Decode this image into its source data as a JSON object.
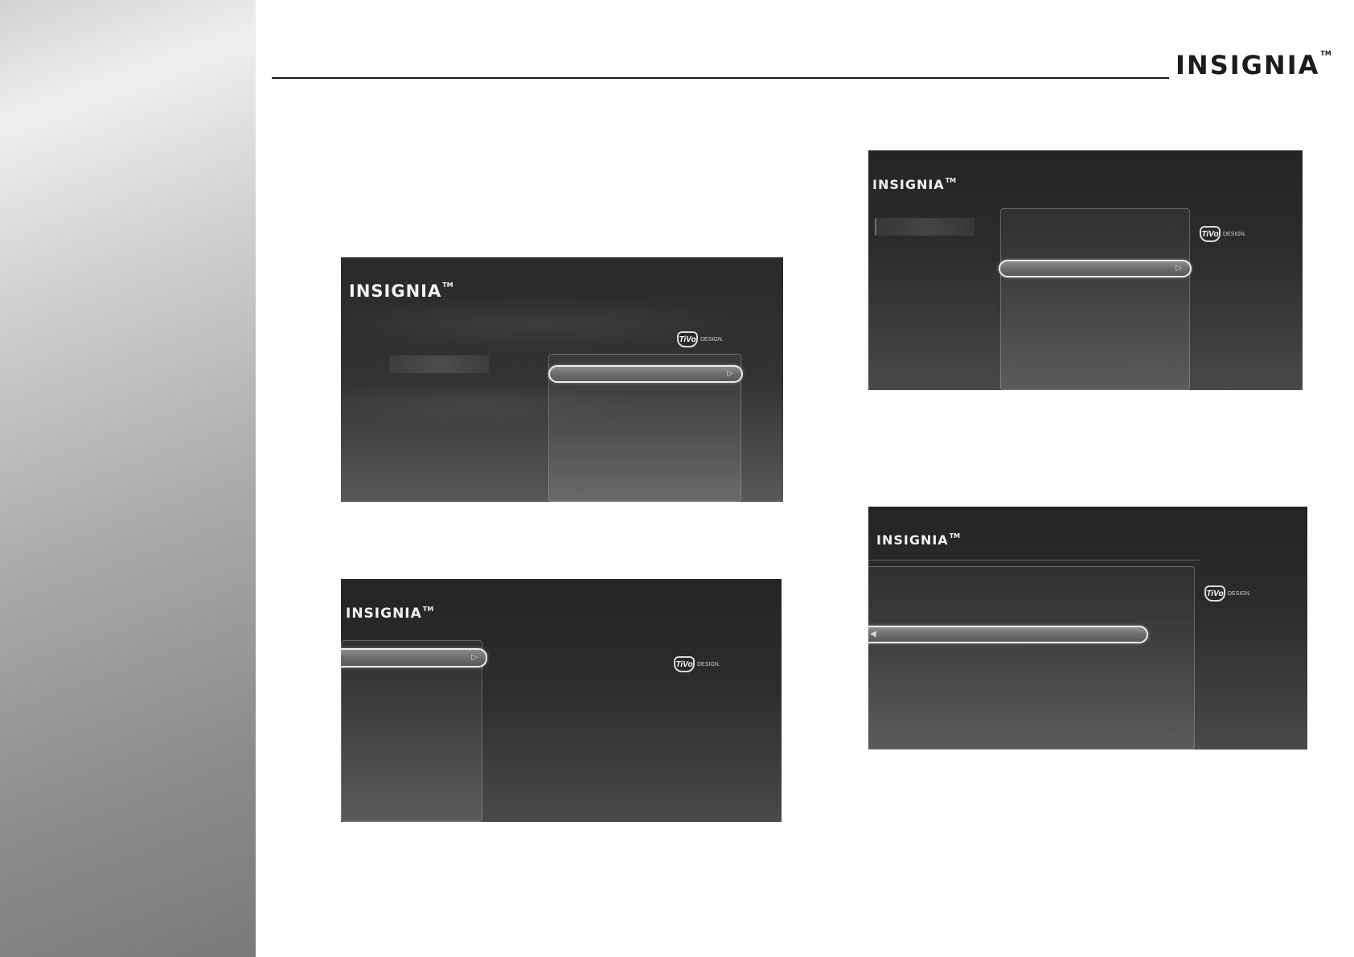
{
  "brand": {
    "logo_text": "INSIGNIA",
    "trademark": "TM"
  },
  "tivo": {
    "badge_text": "TiVo",
    "suffix_text": "DESIGN."
  },
  "screens": [
    {
      "id": "screen-1",
      "logo_text": "INSIGNIA",
      "trademark": "TM"
    },
    {
      "id": "screen-2",
      "logo_text": "INSIGNIA",
      "trademark": "TM"
    },
    {
      "id": "screen-3",
      "logo_text": "INSIGNIA",
      "trademark": "TM"
    },
    {
      "id": "screen-4",
      "logo_text": "INSIGNIA",
      "trademark": "TM"
    }
  ],
  "icons": {
    "arrow_right": "play-arrow-right-icon",
    "arrow_left": "play-arrow-left-icon"
  }
}
